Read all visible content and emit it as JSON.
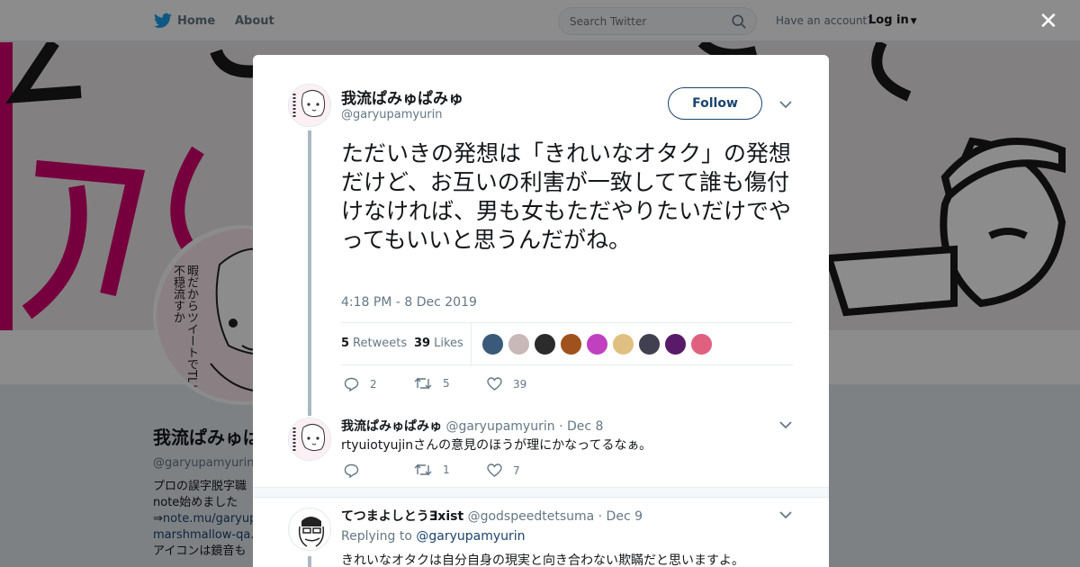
{
  "nav": {
    "home_label": "Home",
    "about_label": "About",
    "search_placeholder": "Search Twitter",
    "have_account": "Have an account?",
    "login_label": "Log in"
  },
  "profile_bg": {
    "avatar_text": "暇だからツイートでTLに不穏流すか",
    "name": "我流ぱみゅぱ",
    "handle": "@garyupamyurin",
    "bio": {
      "line1": "プロの誤字脱字職",
      "line2": "note始めました",
      "line3_prefix": "⇒",
      "line3_link": "note.mu/garyup",
      "line4_link": "marshmallow-qa.c",
      "line5": "アイコンは鏡音も"
    }
  },
  "modal": {
    "main_tweet": {
      "author_name": "我流ぱみゅぱみゅ",
      "author_handle": "@garyupamyurin",
      "follow_label": "Follow",
      "text": "ただいきの発想は「きれいなオタク」の発想だけど、お互いの利害が一致してて誰も傷付けなければ、男も女もただやりたいだけでやってもいいと思うんだがね。",
      "timestamp": "4:18 PM - 8 Dec 2019",
      "retweets_count": "5",
      "retweets_label": "Retweets",
      "likes_count": "39",
      "likes_label": "Likes",
      "reply_count": "2",
      "retweet_count": "5",
      "like_count": "39"
    },
    "reply1": {
      "author_name": "我流ぱみゅぱみゅ",
      "author_handle": "@garyupamyurin",
      "date": "· Dec 8",
      "text": "rtyuiotyujinさんの意見のほうが理にかなってるなぁ。",
      "retweet_count": "1",
      "like_count": "7"
    },
    "reply2": {
      "author_name": "てつまよしとうƎxist",
      "author_handle": "@godspeedtetsuma",
      "date": "· Dec 9",
      "replying_prefix": "Replying to",
      "replying_handle": "@garyupamyurin",
      "text": "きれいなオタクは自分自身の現実と向き合わない欺瞞だと思いますよ。"
    }
  },
  "colors": {
    "link": "#1b4371",
    "twitter_blue": "#1da1f2",
    "muted": "#657786",
    "banner_pink": "#d6006f"
  },
  "icons": [
    "twitter-bird-icon",
    "search-icon",
    "caret-down-icon",
    "close-icon",
    "chevron-down-icon",
    "reply-icon",
    "retweet-icon",
    "heart-icon"
  ],
  "liker_colors": [
    "#3b5a7a",
    "#c9b8b8",
    "#2b2b2b",
    "#a0521d",
    "#c040c0",
    "#e0c080",
    "#404050",
    "#5a1a6a",
    "#e06080"
  ]
}
